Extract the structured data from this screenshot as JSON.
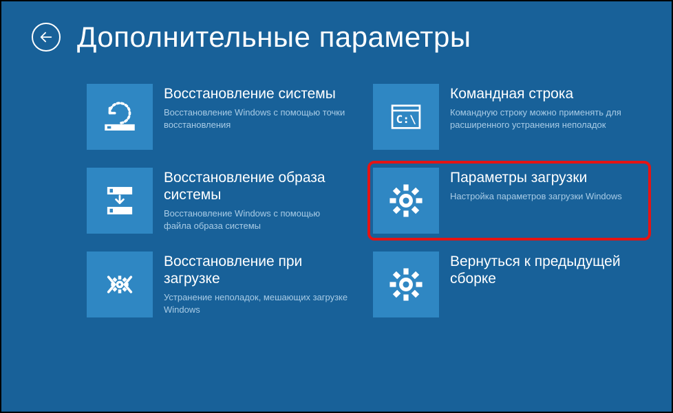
{
  "header": {
    "title": "Дополнительные параметры"
  },
  "tiles": [
    {
      "title": "Восстановление системы",
      "desc": "Восстановление Windows с помощью точки восстановления"
    },
    {
      "title": "Командная строка",
      "desc": "Командную строку можно применять для расширенного устранения неполадок"
    },
    {
      "title": "Восстановление образа системы",
      "desc": "Восстановление Windows с помощью файла образа системы"
    },
    {
      "title": "Параметры загрузки",
      "desc": "Настройка параметров загрузки Windows"
    },
    {
      "title": "Восстановление при загрузке",
      "desc": "Устранение неполадок, мешающих загрузке Windows"
    },
    {
      "title": "Вернуться к предыдущей сборке",
      "desc": ""
    }
  ]
}
